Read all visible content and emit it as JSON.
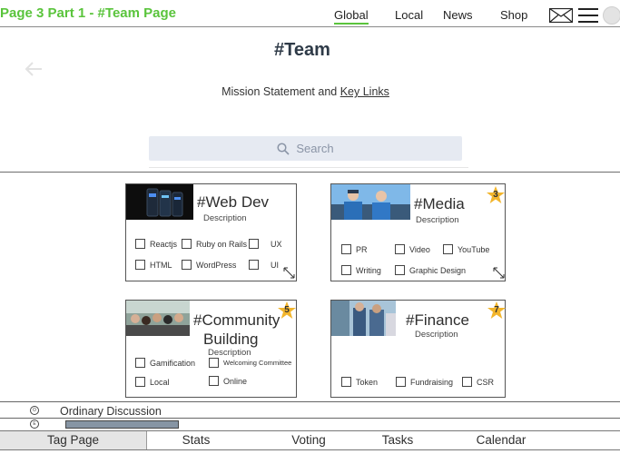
{
  "header": {
    "page_title": "Page 3 Part 1 - #Team Page",
    "nav": [
      {
        "label": "Global",
        "active": true
      },
      {
        "label": "Local",
        "active": false
      },
      {
        "label": "News",
        "active": false
      },
      {
        "label": "Shop",
        "active": false
      }
    ],
    "icons": [
      "mail-icon",
      "menu-icon",
      "avatar"
    ]
  },
  "main": {
    "heading": "#Team",
    "mission_text": "Mission Statement and ",
    "key_links": "Key Links",
    "search_placeholder": "Search"
  },
  "cards": [
    {
      "title": "#Web Dev",
      "description": "Description",
      "badge": null,
      "checks": [
        "Reactjs",
        "Ruby on Rails",
        "UX",
        "HTML",
        "WordPress",
        "UI"
      ]
    },
    {
      "title": "#Media",
      "description": "Description",
      "badge": "3",
      "checks": [
        "PR",
        "Video",
        "YouTube",
        "Writing",
        "Graphic Design"
      ]
    },
    {
      "title_line1": "#Community",
      "title_line2": "Building",
      "description": "Description",
      "badge": "5",
      "checks": [
        "Gamification",
        "Welcoming Committee",
        "Local",
        "Online"
      ]
    },
    {
      "title": "#Finance",
      "description": "Description",
      "badge": "7",
      "checks": [
        "Token",
        "Fundraising",
        "CSR"
      ]
    }
  ],
  "discussion": {
    "label": "Ordinary Discussion",
    "radio_labels": [
      "O",
      "E"
    ]
  },
  "tabs": [
    {
      "label": "Tag Page",
      "active": true
    },
    {
      "label": "Stats",
      "active": false
    },
    {
      "label": "Voting",
      "active": false
    },
    {
      "label": "Tasks",
      "active": false
    },
    {
      "label": "Calendar",
      "active": false
    }
  ],
  "colors": {
    "accent_green": "#5ac43c",
    "badge_star": "#f2b52c",
    "search_bg": "#e6eaf2",
    "progress_fill": "#8795a4"
  }
}
